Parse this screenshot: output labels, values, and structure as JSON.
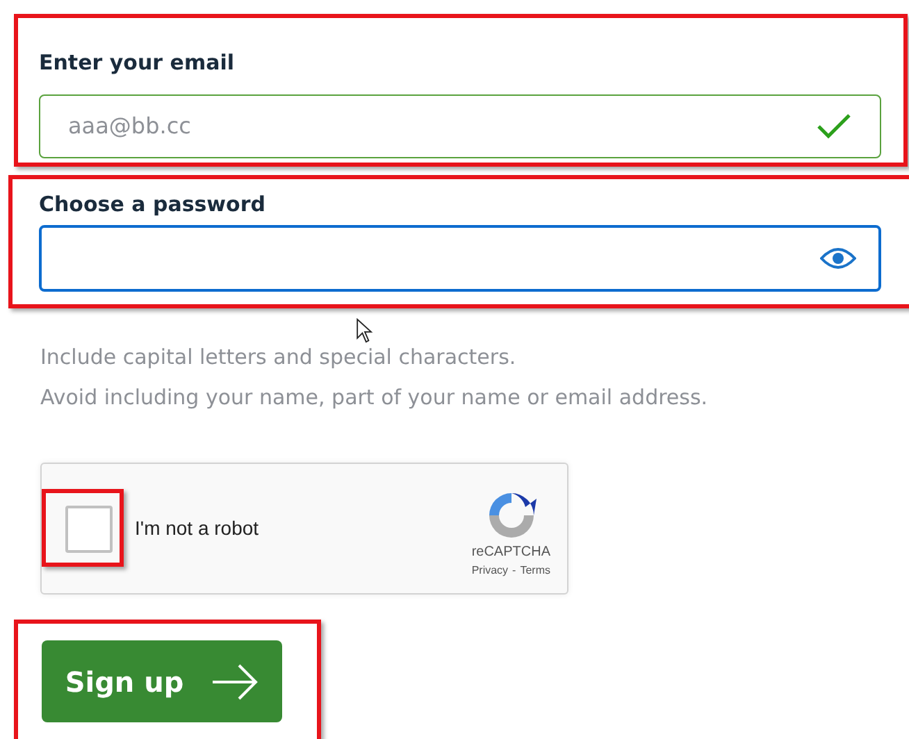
{
  "email": {
    "label": "Enter your email",
    "value": "aaa@bb.cc",
    "valid": true,
    "highlighted": true
  },
  "password": {
    "label": "Choose a password",
    "focused": true,
    "highlighted": true,
    "hints": [
      "Include capital letters and special characters.",
      "Avoid including your name, part of your name or email address."
    ]
  },
  "captcha": {
    "label": "I'm not a robot",
    "checked": false,
    "highlighted": true,
    "brand": "reCAPTCHA",
    "links": [
      "Privacy",
      "Terms"
    ],
    "separator": "-"
  },
  "signup": {
    "label": "Sign up",
    "highlighted": true
  }
}
